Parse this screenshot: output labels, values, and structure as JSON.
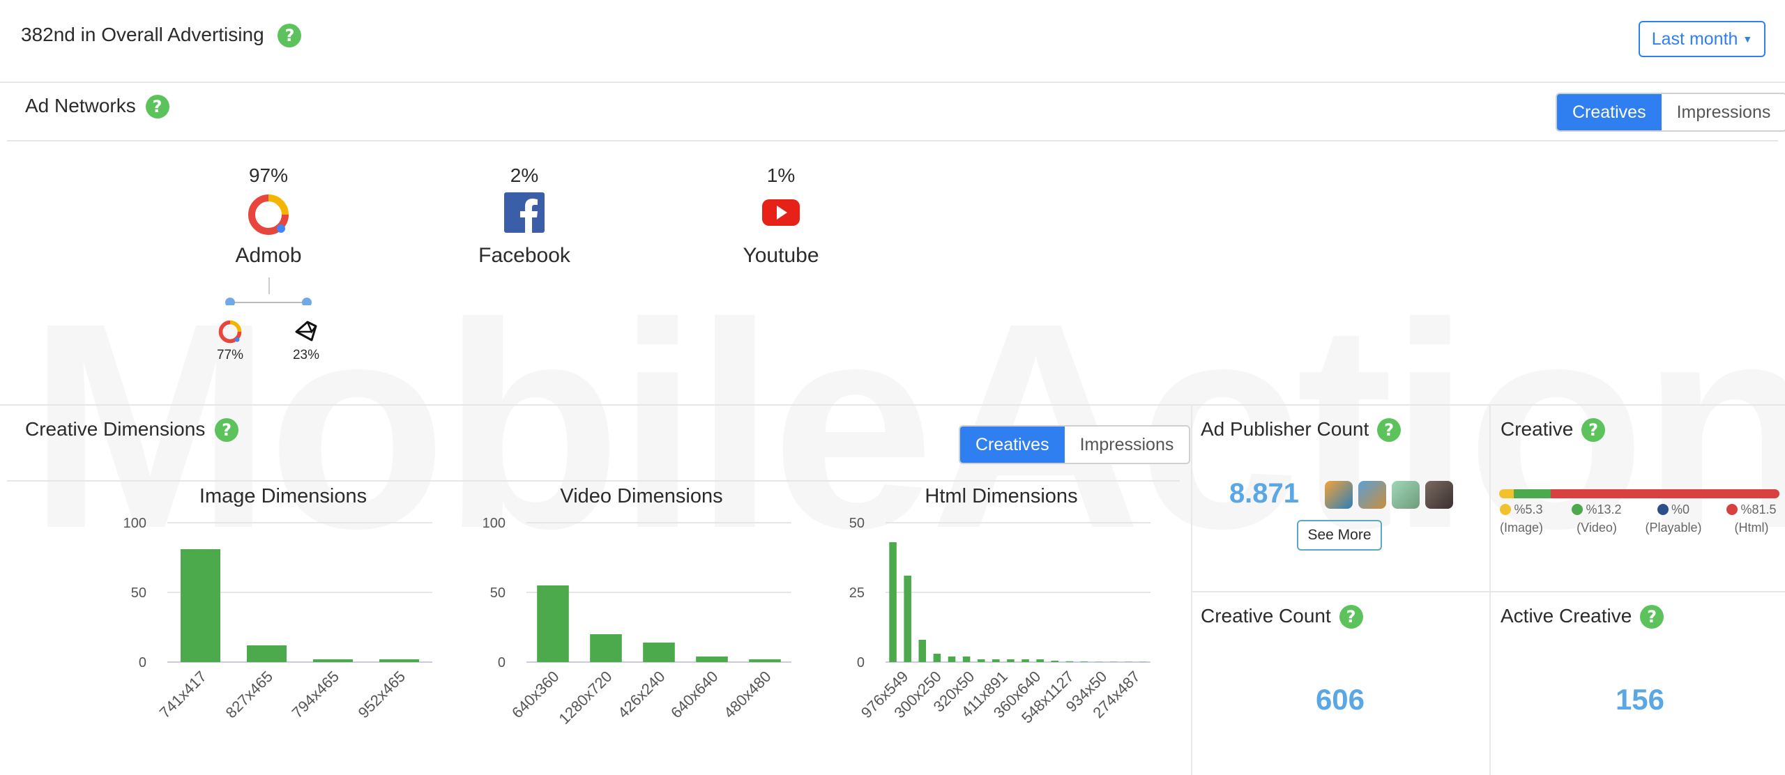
{
  "header": {
    "rank_title": "382nd in Overall Advertising",
    "period_select": "Last month"
  },
  "watermark": "MobileAction",
  "ad_networks": {
    "title": "Ad Networks",
    "toggle": [
      "Creatives",
      "Impressions"
    ],
    "active_toggle": "Creatives",
    "items": [
      {
        "pct": "97%",
        "name": "Admob",
        "icon": "admob-icon"
      },
      {
        "pct": "2%",
        "name": "Facebook",
        "icon": "facebook-icon"
      },
      {
        "pct": "1%",
        "name": "Youtube",
        "icon": "youtube-icon"
      }
    ],
    "sub_split": [
      {
        "pct": "77%",
        "icon": "admob-icon"
      },
      {
        "pct": "23%",
        "icon": "unity-icon"
      }
    ]
  },
  "creative_dimensions": {
    "title": "Creative Dimensions",
    "toggle": [
      "Creatives",
      "Impressions"
    ],
    "active_toggle": "Creatives"
  },
  "chart_data": [
    {
      "type": "bar",
      "title": "Image Dimensions",
      "categories": [
        "741x417",
        "827x465",
        "794x465",
        "952x465"
      ],
      "values": [
        81,
        12,
        2,
        2
      ],
      "ylim": [
        0,
        100
      ],
      "yticks": [
        0,
        50,
        100
      ],
      "color": "#4caa4c"
    },
    {
      "type": "bar",
      "title": "Video Dimensions",
      "categories": [
        "640x360",
        "1280x720",
        "426x240",
        "640x640",
        "480x480"
      ],
      "values": [
        55,
        20,
        14,
        4,
        2
      ],
      "ylim": [
        0,
        100
      ],
      "yticks": [
        0,
        50,
        100
      ],
      "color": "#4caa4c"
    },
    {
      "type": "bar",
      "title": "Html Dimensions",
      "categories": [
        "976x549",
        "300x250",
        "320x50",
        "411x891",
        "360x640",
        "548x1127",
        "934x50",
        "274x487"
      ],
      "values": [
        43,
        31,
        8,
        3,
        2,
        2,
        1,
        1,
        1,
        1,
        1,
        0.5,
        0.3,
        0.2,
        0.1,
        0.1,
        0.1,
        0.1
      ],
      "ylim": [
        0,
        50
      ],
      "yticks": [
        0,
        25,
        50
      ],
      "color": "#4caa4c"
    }
  ],
  "ad_publisher": {
    "title": "Ad Publisher Count",
    "value": "8.871",
    "see_more": "See More",
    "thumbs": [
      "game-thumb-1",
      "game-thumb-2",
      "game-thumb-3",
      "game-thumb-4"
    ]
  },
  "creative_mix": {
    "title": "Creative",
    "segments": [
      {
        "label": "%5.3",
        "type": "(Image)",
        "value": 5.3,
        "color": "#f2c12e"
      },
      {
        "label": "%13.2",
        "type": "(Video)",
        "value": 13.2,
        "color": "#4caa4c"
      },
      {
        "label": "%0",
        "type": "(Playable)",
        "value": 0,
        "color": "#2d4e8a"
      },
      {
        "label": "%81.5",
        "type": "(Html)",
        "value": 81.5,
        "color": "#d94040"
      }
    ]
  },
  "creative_count": {
    "title": "Creative Count",
    "value": "606"
  },
  "active_creative": {
    "title": "Active Creative",
    "value": "156"
  }
}
